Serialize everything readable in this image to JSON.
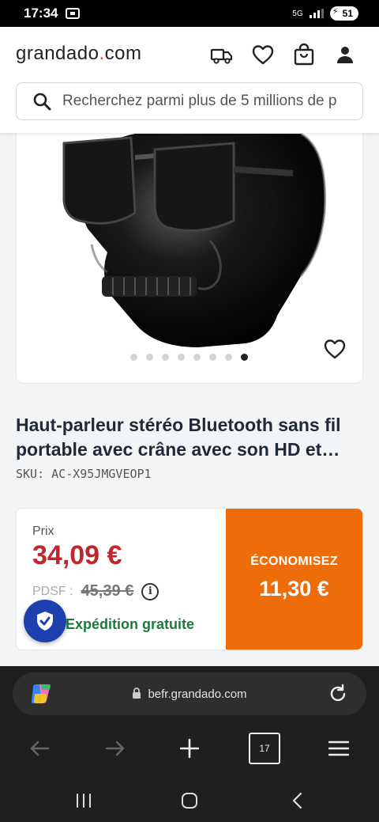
{
  "status_bar": {
    "time": "17:34",
    "network": "5G",
    "battery": "51"
  },
  "header": {
    "logo_left": "grandado",
    "logo_dot": ".",
    "logo_right": "com",
    "icons": [
      "delivery-truck-icon",
      "heart-icon",
      "shopping-bag-icon",
      "user-icon"
    ]
  },
  "search": {
    "placeholder": "Recherchez parmi plus de 5 millions de p"
  },
  "product": {
    "image_dots_total": 8,
    "image_dots_active": 8,
    "title": "Haut-parleur stéréo Bluetooth sans fil portable avec crâne avec son HD et…",
    "sku": "SKU: AC-X95JMGVEOP1"
  },
  "pricing": {
    "price_label": "Prix",
    "price": "34,09 €",
    "rrp_label": "PDSF :",
    "rrp": "45,39 €",
    "info_icon": "i",
    "shipping": "Expédition gratuite",
    "save_label": "ÉCONOMISEZ",
    "save_value": "11,30 €",
    "colors": {
      "price": "#c0262d",
      "save_bg": "#ee6c0a",
      "shipping": "#1a7a3e"
    }
  },
  "browser": {
    "url": "befr.grandado.com",
    "tab_count": "17"
  }
}
